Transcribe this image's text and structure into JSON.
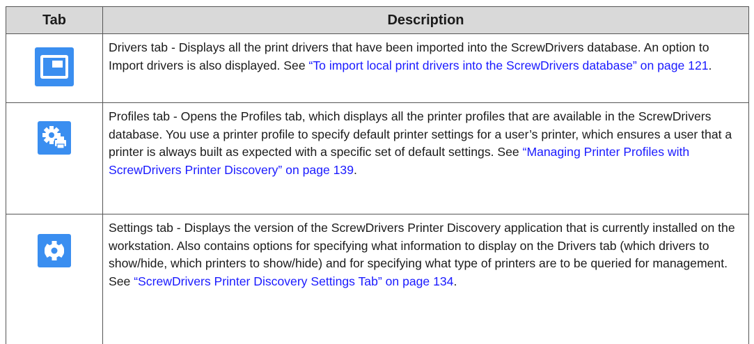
{
  "header": {
    "tab_label": "Tab",
    "description_label": "Description"
  },
  "rows": [
    {
      "icon": "drivers-window-icon",
      "text": "Drivers tab - Displays all the print drivers that have been imported into the ScrewDrivers database. An option to Import drivers is also displayed. See ",
      "link": "“To import local print drivers into the ScrewDrivers database” on page 121",
      "tail": "."
    },
    {
      "icon": "profiles-gear-printer-icon",
      "text": "Profiles tab - Opens the Profiles tab, which displays all the printer profiles that are available in the ScrewDrivers database. You use a printer profile to specify default printer settings for a user’s printer, which ensures a user that a printer is always built as expected with a specific set of default settings. See ",
      "link": "“Managing Printer Profiles with ScrewDrivers Printer Discovery” on page 139",
      "tail": "."
    },
    {
      "icon": "settings-gear-icon",
      "text": "Settings tab - Displays the version of the ScrewDrivers Printer Discovery application that is currently installed on the workstation. Also contains options for specifying what information to display on the Drivers tab (which drivers to show/hide, which printers to show/hide) and for specifying what type of printers are to be queried for management. See ",
      "link": "“ScrewDrivers Printer Discovery Settings Tab” on page 134",
      "tail": "."
    }
  ],
  "colors": {
    "icon_background": "#3a8ef0",
    "link": "#1a1aff",
    "header_background": "#d9d9d9"
  }
}
